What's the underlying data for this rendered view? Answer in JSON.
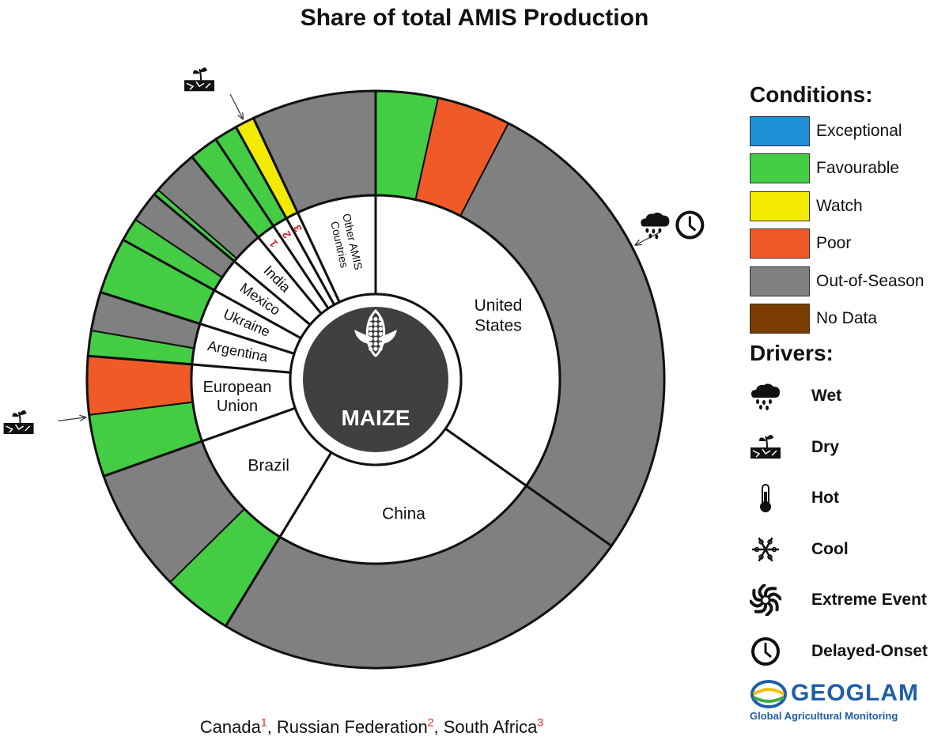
{
  "chart_data": {
    "type": "donut",
    "title": "Share of total AMIS Production",
    "center_label": "MAIZE",
    "center_icon": "corn-icon",
    "countries": [
      {
        "name": "United States",
        "share": 0.32,
        "conditions": [
          {
            "condition": "Favourable",
            "share": 0.032
          },
          {
            "condition": "Poor",
            "share": 0.038
          },
          {
            "condition": "Out-of-Season",
            "share": 0.25
          }
        ],
        "drivers": [
          "wet-icon",
          "delayed-onset-icon"
        ]
      },
      {
        "name": "China",
        "share": 0.22,
        "conditions": [
          {
            "condition": "Out-of-Season",
            "share": 0.22
          }
        ]
      },
      {
        "name": "Brazil",
        "share": 0.1,
        "conditions": [
          {
            "condition": "Favourable",
            "share": 0.036
          },
          {
            "condition": "Out-of-Season",
            "share": 0.064
          }
        ]
      },
      {
        "name": "European Union",
        "share": 0.062,
        "conditions": [
          {
            "condition": "Favourable",
            "share": 0.032
          },
          {
            "condition": "Poor",
            "share": 0.03
          }
        ],
        "drivers": [
          "hot-icon",
          "dry-icon"
        ]
      },
      {
        "name": "Argentina",
        "share": 0.033,
        "conditions": [
          {
            "condition": "Favourable",
            "share": 0.013
          },
          {
            "condition": "Out-of-Season",
            "share": 0.02
          }
        ]
      },
      {
        "name": "Ukraine",
        "share": 0.029,
        "conditions": [
          {
            "condition": "Favourable",
            "share": 0.029
          }
        ]
      },
      {
        "name": "Mexico",
        "share": 0.028,
        "conditions": [
          {
            "condition": "Favourable",
            "share": 0.012
          },
          {
            "condition": "Out-of-Season",
            "share": 0.016
          }
        ]
      },
      {
        "name": "India",
        "share": 0.027,
        "conditions": [
          {
            "condition": "Favourable",
            "share": 0.003
          },
          {
            "condition": "Out-of-Season",
            "share": 0.024
          }
        ]
      },
      {
        "name": "Canada",
        "marker": "1",
        "share": 0.015,
        "conditions": [
          {
            "condition": "Favourable",
            "share": 0.015
          }
        ]
      },
      {
        "name": "Russian Federation",
        "marker": "2",
        "share": 0.012,
        "conditions": [
          {
            "condition": "Favourable",
            "share": 0.012
          }
        ]
      },
      {
        "name": "South Africa",
        "marker": "3",
        "share": 0.01,
        "conditions": [
          {
            "condition": "Watch",
            "share": 0.01
          }
        ],
        "drivers": [
          "dry-icon"
        ]
      },
      {
        "name": "Other AMIS Countries",
        "share": 0.064,
        "conditions": [
          {
            "condition": "Out-of-Season",
            "share": 0.064
          }
        ]
      }
    ]
  },
  "legend": {
    "conditions_title": "Conditions:",
    "conditions": [
      {
        "label": "Exceptional",
        "color": "#1f8fd6"
      },
      {
        "label": "Favourable",
        "color": "#44cc44"
      },
      {
        "label": "Watch",
        "color": "#f2ea00"
      },
      {
        "label": "Poor",
        "color": "#f05a28"
      },
      {
        "label": "Out-of-Season",
        "color": "#808080"
      },
      {
        "label": "No Data",
        "color": "#7a3c00"
      }
    ],
    "drivers_title": "Drivers:",
    "drivers": [
      {
        "label": "Wet",
        "icon": "wet-icon"
      },
      {
        "label": "Dry",
        "icon": "dry-icon"
      },
      {
        "label": "Hot",
        "icon": "hot-icon"
      },
      {
        "label": "Cool",
        "icon": "cool-icon"
      },
      {
        "label": "Extreme Event",
        "icon": "extreme-event-icon"
      },
      {
        "label": "Delayed-Onset",
        "icon": "delayed-onset-icon"
      }
    ]
  },
  "logo": {
    "wordmark": "GEOGLAM",
    "subtitle": "Global Agricultural Monitoring"
  },
  "footnote": {
    "items": [
      {
        "name": "Canada",
        "marker": "1"
      },
      {
        "name": "Russian Federation",
        "marker": "2"
      },
      {
        "name": "South Africa",
        "marker": "3"
      }
    ]
  }
}
